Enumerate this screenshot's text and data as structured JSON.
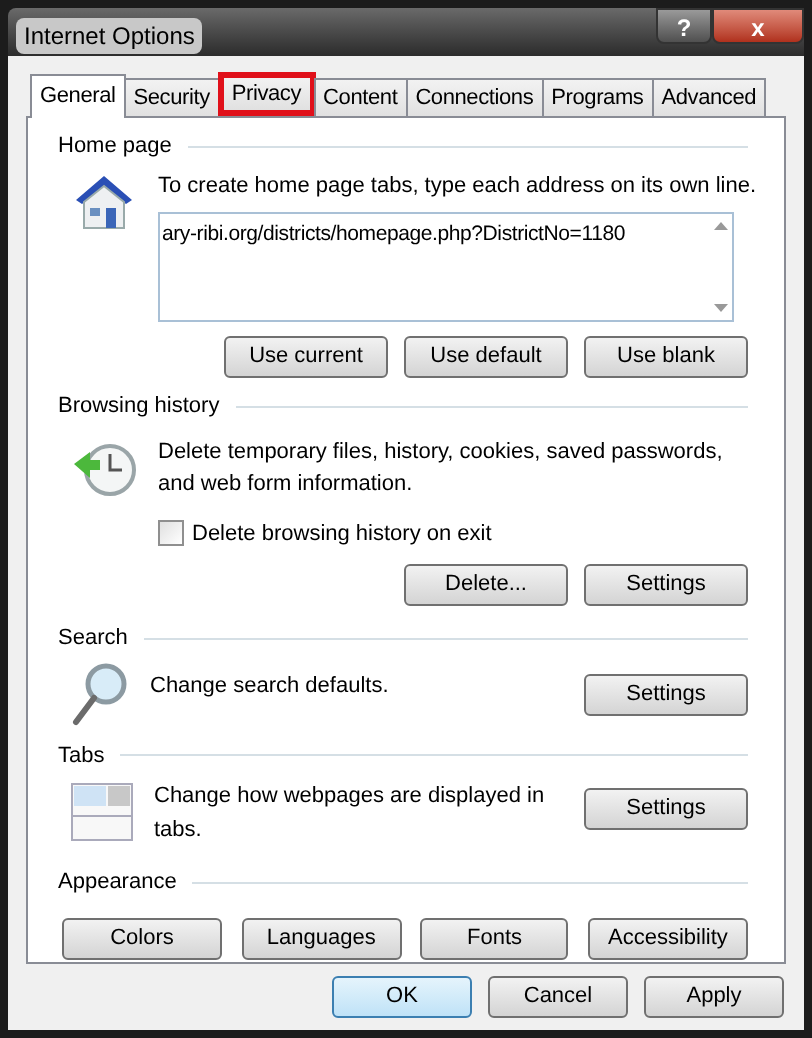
{
  "window": {
    "title": "Internet Options",
    "controls": [
      {
        "kind": "help",
        "label": "?"
      },
      {
        "kind": "close",
        "label": "x"
      }
    ]
  },
  "tabs": [
    {
      "label": "General",
      "selected": true,
      "highlighted": false
    },
    {
      "label": "Security",
      "selected": false,
      "highlighted": false
    },
    {
      "label": "Privacy",
      "selected": false,
      "highlighted": true
    },
    {
      "label": "Content",
      "selected": false,
      "highlighted": false
    },
    {
      "label": "Connections",
      "selected": false,
      "highlighted": false
    },
    {
      "label": "Programs",
      "selected": false,
      "highlighted": false
    },
    {
      "label": "Advanced",
      "selected": false,
      "highlighted": false
    }
  ],
  "home_page": {
    "heading": "Home page",
    "description": "To create home page tabs, type each address on its own line.",
    "address": "ary-ribi.org/districts/homepage.php?DistrictNo=1180",
    "buttons": [
      "Use current",
      "Use default",
      "Use blank"
    ]
  },
  "browsing_history": {
    "heading": "Browsing history",
    "description": "Delete temporary files, history, cookies, saved passwords, and web form information.",
    "checkbox": {
      "label": "Delete browsing history on exit",
      "checked": false
    },
    "buttons": [
      "Delete...",
      "Settings"
    ]
  },
  "search": {
    "heading": "Search",
    "description": "Change search defaults.",
    "button": "Settings"
  },
  "tabs_section": {
    "heading": "Tabs",
    "description": "Change how webpages are displayed in tabs.",
    "button": "Settings"
  },
  "appearance": {
    "heading": "Appearance",
    "buttons": [
      "Colors",
      "Languages",
      "Fonts",
      "Accessibility"
    ]
  },
  "footer_buttons": [
    {
      "label": "OK",
      "default": true
    },
    {
      "label": "Cancel",
      "default": false
    },
    {
      "label": "Apply",
      "default": false
    }
  ]
}
